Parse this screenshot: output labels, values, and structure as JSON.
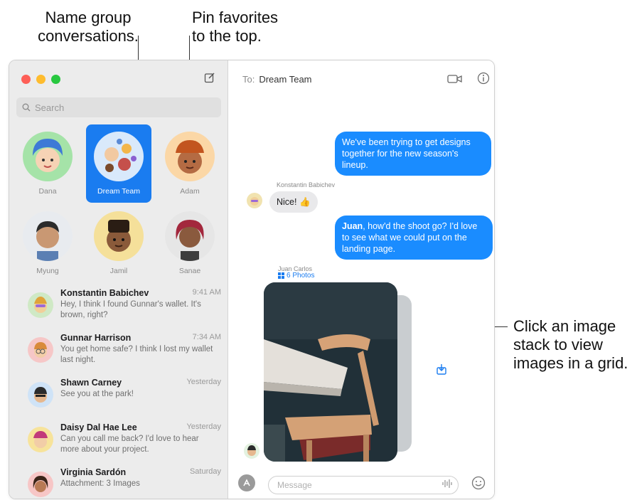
{
  "callouts": {
    "group": [
      "Name group",
      "conversations."
    ],
    "pin": [
      "Pin favorites",
      "to the top."
    ],
    "stack": [
      "Click an image",
      "stack to view",
      "images in a grid."
    ]
  },
  "sidebar": {
    "search_placeholder": "Search",
    "pinned": [
      {
        "label": "Dana"
      },
      {
        "label": "Dream Team",
        "selected": true
      },
      {
        "label": "Adam"
      },
      {
        "label": "Myung"
      },
      {
        "label": "Jamil"
      },
      {
        "label": "Sanae"
      }
    ],
    "conversations": [
      {
        "name": "Konstantin Babichev",
        "time": "9:41 AM",
        "preview": "Hey, I think I found Gunnar's wallet. It's brown, right?"
      },
      {
        "name": "Gunnar Harrison",
        "time": "7:34 AM",
        "preview": "You get home safe? I think I lost my wallet last night."
      },
      {
        "name": "Shawn Carney",
        "time": "Yesterday",
        "preview": "See you at the park!"
      },
      {
        "name": "Daisy Dal Hae Lee",
        "time": "Yesterday",
        "preview": "Can you call me back? I'd love to hear more about your project."
      },
      {
        "name": "Virginia Sardón",
        "time": "Saturday",
        "preview": "Attachment: 3 Images"
      }
    ]
  },
  "conversation": {
    "to_label": "To:",
    "recipient": "Dream Team",
    "messages": {
      "m1": "We've been trying to get designs together for the new season's lineup.",
      "m2_sender": "Konstantin Babichev",
      "m2": "Nice! 👍",
      "m3_name": "Juan",
      "m3_rest": ", how'd the shoot go? I'd love to see what we could put on the landing page.",
      "m4_sender": "Juan Carlos",
      "m4_photos": "6 Photos"
    },
    "input_placeholder": "Message"
  },
  "colors": {
    "accent": "#1a7cf0",
    "bubble_blue": "#1a8cff",
    "traffic_red": "#fe5f57",
    "traffic_yellow": "#febc2e",
    "traffic_green": "#28c840"
  }
}
